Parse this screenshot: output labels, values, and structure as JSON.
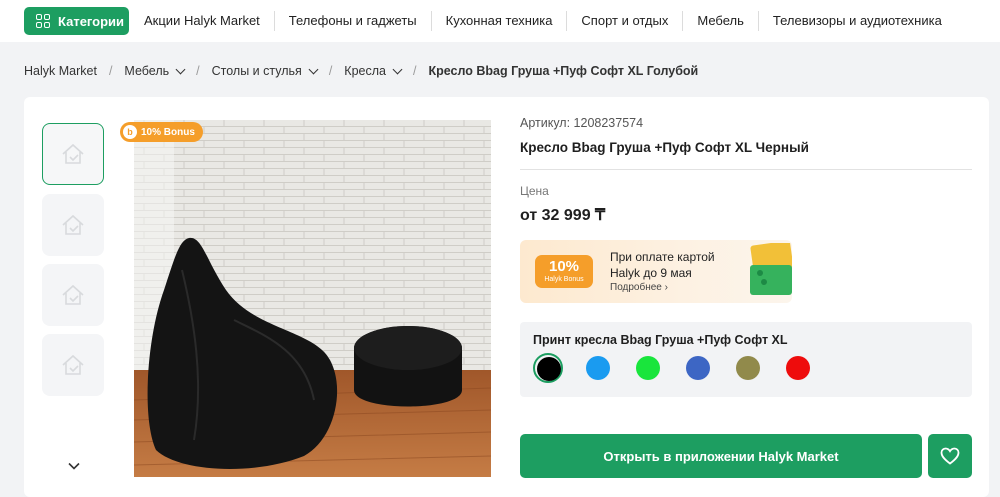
{
  "header": {
    "categories_label": "Категории",
    "nav": [
      "Акции Halyk Market",
      "Телефоны и гаджеты",
      "Кухонная техника",
      "Спорт и отдых",
      "Мебель",
      "Телевизоры и аудиотехника"
    ]
  },
  "breadcrumbs": [
    {
      "label": "Halyk Market",
      "dropdown": false
    },
    {
      "label": "Мебель",
      "dropdown": true
    },
    {
      "label": "Столы и стулья",
      "dropdown": true
    },
    {
      "label": "Кресла",
      "dropdown": true
    },
    {
      "label": "Кресло Bbag Груша +Пуф Софт XL Голубой",
      "dropdown": false
    }
  ],
  "product": {
    "bonus_tag": "10% Bonus",
    "bonus_tag_icon": "b",
    "article": "Артикул: 1208237574",
    "title": "Кресло Bbag Груша +Пуф Софт XL Черный",
    "price_label": "Цена",
    "price": "от 32 999 ₸"
  },
  "promo": {
    "badge_pct": "10%",
    "badge_sub": "Halyk Bonus",
    "line1": "При оплате картой",
    "line2": "Halyk до 9 мая",
    "more": "Подробнее ›"
  },
  "variants": {
    "title": "Принт кресла Bbag Груша +Пуф Софт XL",
    "colors": [
      "#000000",
      "#1a9bf0",
      "#19e53c",
      "#3d66c4",
      "#918a4b",
      "#ee0c0c"
    ],
    "selected_index": 0
  },
  "actions": {
    "open_app": "Открыть в приложении Halyk Market"
  },
  "colors": {
    "accent": "#1d9e61",
    "bonus": "#f59e2a"
  }
}
